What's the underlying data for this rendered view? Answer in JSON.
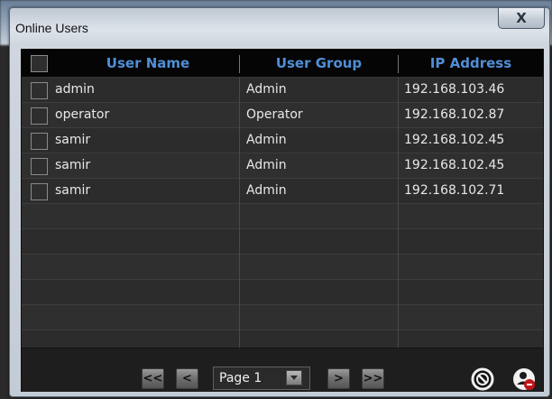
{
  "window": {
    "title": "Online Users",
    "close_label": "X"
  },
  "table": {
    "columns": [
      "User Name",
      "User Group",
      "IP Address"
    ],
    "rows": [
      {
        "user": "admin",
        "group": "Admin",
        "ip": "192.168.103.46"
      },
      {
        "user": "operator",
        "group": "Operator",
        "ip": "192.168.102.87"
      },
      {
        "user": "samir",
        "group": "Admin",
        "ip": "192.168.102.45"
      },
      {
        "user": "samir",
        "group": "Admin",
        "ip": "192.168.102.45"
      },
      {
        "user": "samir",
        "group": "Admin",
        "ip": "192.168.102.71"
      }
    ],
    "empty_rows": 6
  },
  "pagination": {
    "first_label": "<<",
    "prev_label": "<",
    "page_label": "Page 1",
    "next_label": ">",
    "last_label": ">>"
  },
  "icons": {
    "disable": "block-icon",
    "kick": "user-remove-icon"
  },
  "colors": {
    "header_text": "#4f8fd6",
    "panel_bg": "#2b2b2b",
    "accent_red": "#c0161a"
  }
}
